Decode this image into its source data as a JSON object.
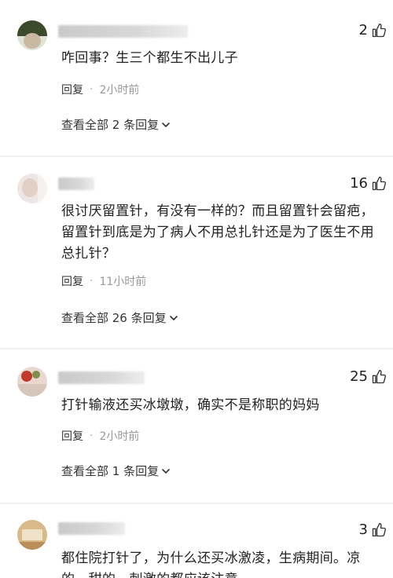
{
  "comments": [
    {
      "likes": "2",
      "text": "咋回事？生三个都生不出儿子",
      "reply_label": "回复",
      "time": "2小时前",
      "expand_label": "查看全部 2 条回复"
    },
    {
      "likes": "16",
      "text": "很讨厌留置针，有没有一样的？而且留置针会留疤，留置针到底是为了病人不用总扎针还是为了医生不用总扎针？",
      "reply_label": "回复",
      "time": "11小时前",
      "expand_label": "查看全部 26 条回复"
    },
    {
      "likes": "25",
      "text": "打针输液还买冰墩墩，确实不是称职的妈妈",
      "reply_label": "回复",
      "time": "2小时前",
      "expand_label": "查看全部 1 条回复"
    },
    {
      "likes": "3",
      "text": "都住院打针了，为什么还买冰激凌，生病期间。凉的，甜的，刺激的都应该注意"
    }
  ],
  "icons": {
    "like": "thumbs-up-icon",
    "expand": "chevron-down-icon"
  }
}
